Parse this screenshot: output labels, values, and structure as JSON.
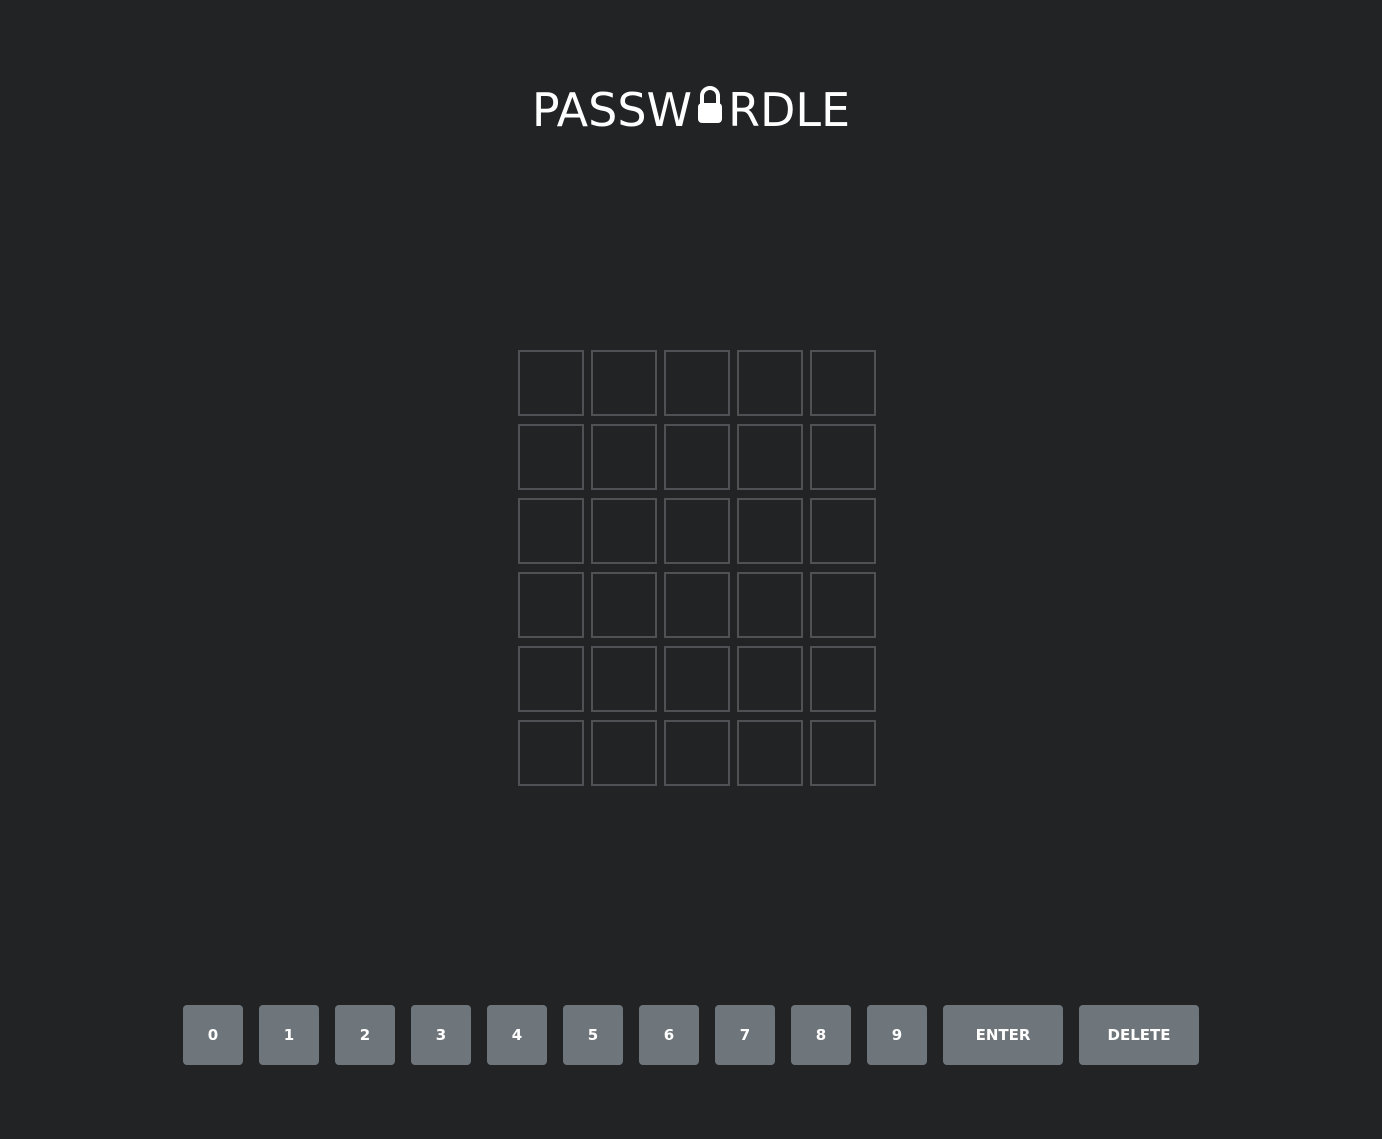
{
  "header": {
    "title_left": "PASSW",
    "title_right": "RDLE",
    "logo_icon": "lock-icon"
  },
  "board": {
    "rows": 6,
    "columns": 5,
    "tiles": [
      [
        "",
        "",
        "",
        "",
        ""
      ],
      [
        "",
        "",
        "",
        "",
        ""
      ],
      [
        "",
        "",
        "",
        "",
        ""
      ],
      [
        "",
        "",
        "",
        "",
        ""
      ],
      [
        "",
        "",
        "",
        "",
        ""
      ],
      [
        "",
        "",
        "",
        "",
        ""
      ]
    ],
    "tile_border_color": "#4f5155"
  },
  "keyboard": {
    "digit_keys": [
      "0",
      "1",
      "2",
      "3",
      "4",
      "5",
      "6",
      "7",
      "8",
      "9"
    ],
    "enter_label": "ENTER",
    "delete_label": "DELETE",
    "key_color": "#6f767b"
  },
  "theme": {
    "background": "#222325",
    "text": "#ffffff"
  }
}
